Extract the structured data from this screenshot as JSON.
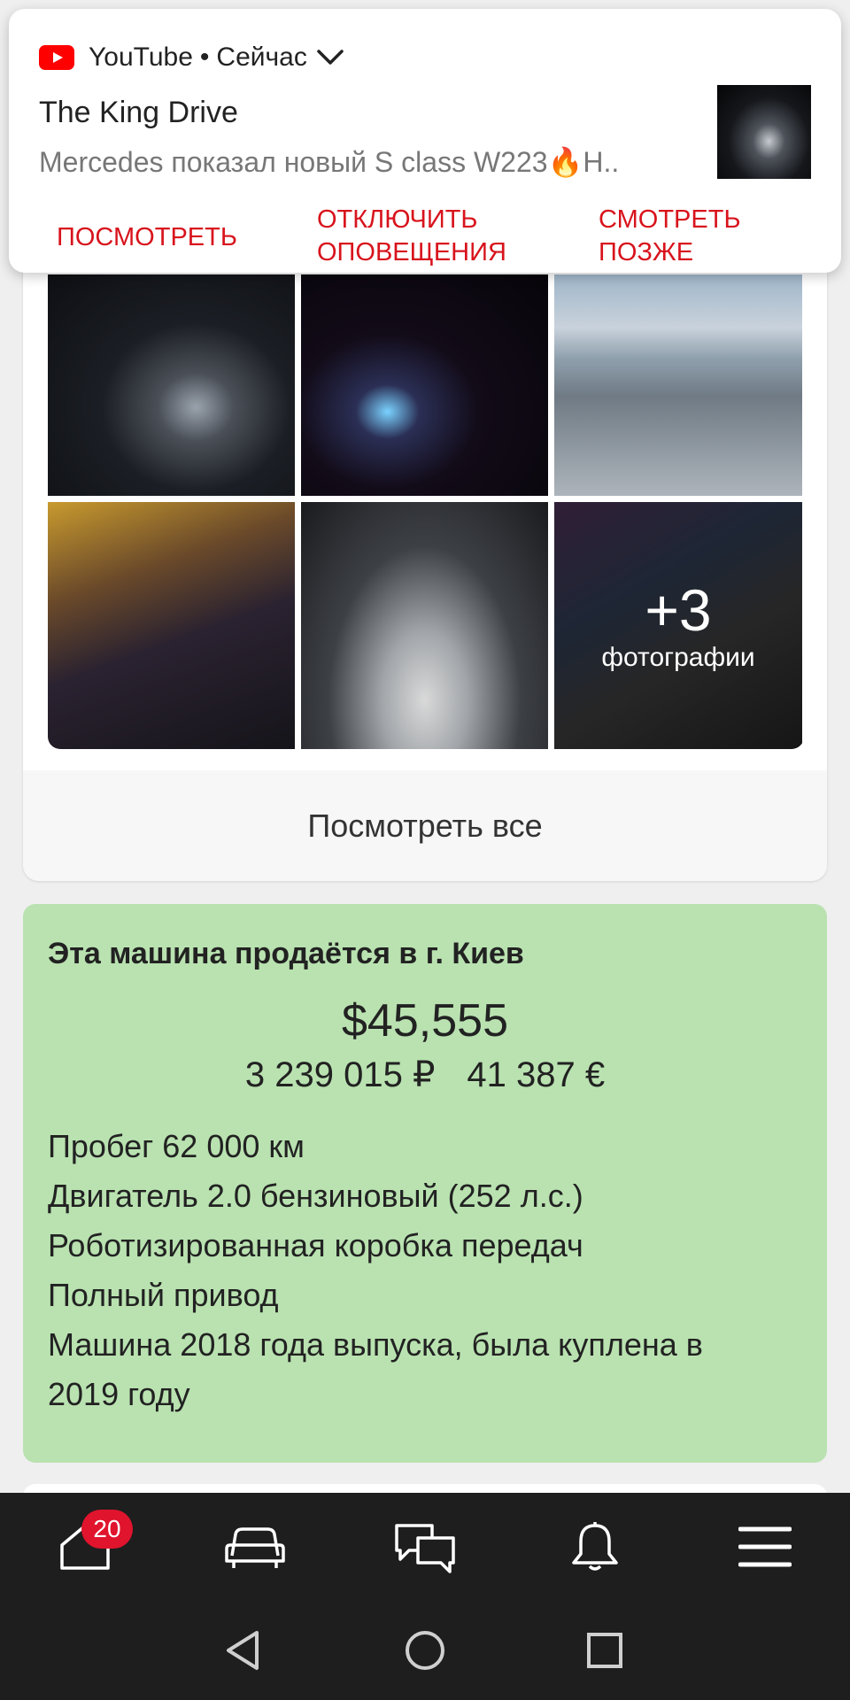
{
  "notification": {
    "app_name": "YouTube",
    "separator": "•",
    "time": "Сейчас",
    "title": "The King Drive",
    "text": "Mercedes показал новый S class W223🔥Н..",
    "actions": [
      "ПОСМОТРЕТЬ",
      "ОТКЛЮЧИТЬ\nОПОВЕЩЕНИЯ",
      "СМОТРЕТЬ\nПОЗЖЕ"
    ]
  },
  "gallery": {
    "more_count": "+3",
    "more_label": "фотографии",
    "view_all": "Посмотреть все"
  },
  "sale": {
    "title": "Эта машина продаётся в г. Киев",
    "price_usd": "$45,555",
    "price_rub": "3 239 015 ₽",
    "price_eur": "41 387 €",
    "specs": [
      "Пробег 62 000 км",
      "Двигатель 2.0 бензиновый (252 л.с.)",
      "Роботизированная коробка передач",
      "Полный привод",
      "Машина 2018 года выпуска, была куплена в",
      "2019 году"
    ]
  },
  "bottom_nav": {
    "badge_count": "20",
    "icons": [
      "home-icon",
      "car-icon",
      "chat-icon",
      "bell-icon",
      "menu-icon"
    ]
  },
  "colors": {
    "accent": "#d8131c",
    "badge": "#e0142d",
    "sale_bg": "#b9e2b0",
    "nav_bg": "#1e1e1e"
  }
}
